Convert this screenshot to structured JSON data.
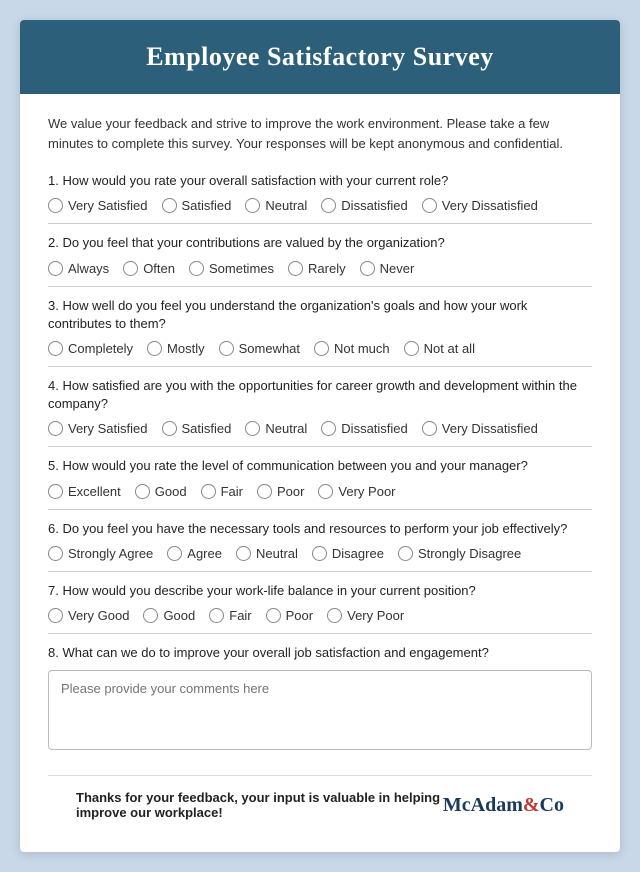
{
  "header": {
    "title": "Employee Satisfactory Survey"
  },
  "intro": "We value your feedback and strive to improve the work environment. Please take a few minutes to complete this survey. Your responses will be kept anonymous and confidential.",
  "questions": [
    {
      "number": "1.",
      "text": "How would you rate your overall satisfaction with your current role?",
      "options": [
        "Very Satisfied",
        "Satisfied",
        "Neutral",
        "Dissatisfied",
        "Very Dissatisfied"
      ]
    },
    {
      "number": "2.",
      "text": "Do you feel that your contributions are valued by the organization?",
      "options": [
        "Always",
        "Often",
        "Sometimes",
        "Rarely",
        "Never"
      ]
    },
    {
      "number": "3.",
      "text": "How well do you feel you understand the organization's goals and how your work contributes to them?",
      "options": [
        "Completely",
        "Mostly",
        "Somewhat",
        "Not much",
        "Not at all"
      ]
    },
    {
      "number": "4.",
      "text": "How satisfied are you with the opportunities for career growth and development within the company?",
      "options": [
        "Very Satisfied",
        "Satisfied",
        "Neutral",
        "Dissatisfied",
        "Very Dissatisfied"
      ]
    },
    {
      "number": "5.",
      "text": "How would you rate the level of communication between you and your manager?",
      "options": [
        "Excellent",
        "Good",
        "Fair",
        "Poor",
        "Very Poor"
      ]
    },
    {
      "number": "6.",
      "text": "Do you feel you have the necessary tools and resources to perform your job effectively?",
      "options": [
        "Strongly Agree",
        "Agree",
        "Neutral",
        "Disagree",
        "Strongly Disagree"
      ]
    },
    {
      "number": "7.",
      "text": "How would you describe your work-life balance in your current position?",
      "options": [
        "Very Good",
        "Good",
        "Fair",
        "Poor",
        "Very Poor"
      ]
    },
    {
      "number": "8.",
      "text": "What can we do to improve your overall job satisfaction and engagement?",
      "textarea_placeholder": "Please provide your comments here"
    }
  ],
  "footer": {
    "thanks": "Thanks for your feedback, your input is valuable in helping improve our workplace!",
    "brand": "McAdam&Co"
  }
}
